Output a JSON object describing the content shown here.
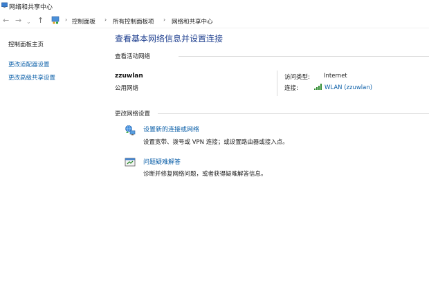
{
  "window": {
    "title": "网络和共享中心"
  },
  "address_bar": {
    "breadcrumbs": [
      "控制面板",
      "所有控制面板项",
      "网络和共享中心"
    ]
  },
  "sidebar": {
    "items": [
      {
        "label": "控制面板主页"
      },
      {
        "label": "更改适配器设置"
      },
      {
        "label": "更改高级共享设置"
      }
    ]
  },
  "main": {
    "title": "查看基本网络信息并设置连接",
    "active_networks": {
      "heading": "查看活动网络",
      "network_name": "zzuwlan",
      "network_category": "公用网络",
      "access_type_label": "访问类型:",
      "access_type_value": "Internet",
      "connection_label": "连接:",
      "connection_value": "WLAN (zzuwlan)"
    },
    "change_settings": {
      "heading": "更改网络设置",
      "tasks": [
        {
          "label": "设置新的连接或网络",
          "description": "设置宽带、拨号或 VPN 连接；或设置路由器或接入点。",
          "icon": "network-setup-icon"
        },
        {
          "label": "问题疑难解答",
          "description": "诊断并修复网络问题，或者获得疑难解答信息。",
          "icon": "troubleshoot-icon"
        }
      ]
    }
  },
  "colors": {
    "link": "#0b5fa8",
    "title": "#1e3f8f"
  }
}
